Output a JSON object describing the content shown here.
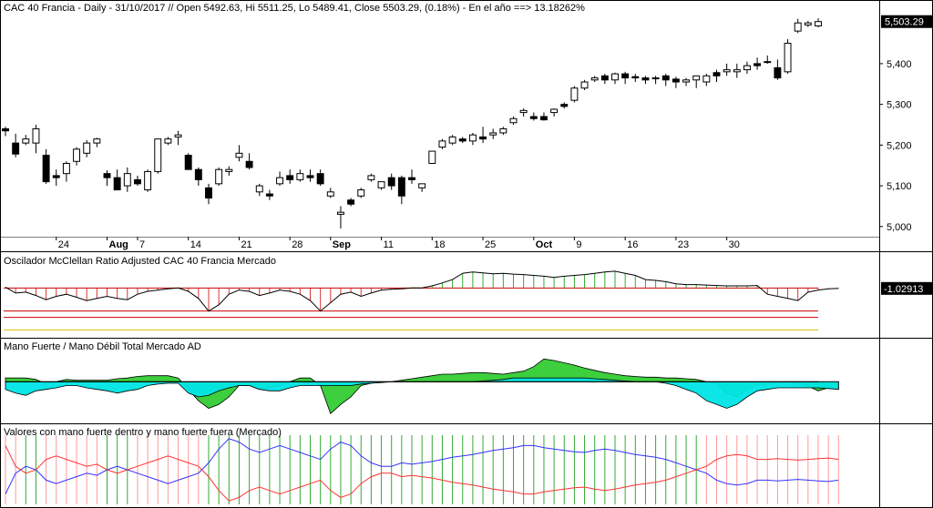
{
  "chart_data": [
    {
      "type": "candlestick",
      "title": "CAC 40 Francia - Daily - 31/10/2017 // Open 5492.63, Hi 5511.25, Lo 5489.41, Close 5503.29, (0.18%) - En el año ==> 13.18262%",
      "ylim": [
        4975,
        5525
      ],
      "yticks": [
        5000,
        5100,
        5200,
        5300,
        5400
      ],
      "ytick_labels": [
        "5,000",
        "5,100",
        "5,200",
        "5,300",
        "5,400"
      ],
      "last_value_label": "5,503.29",
      "last_value": 5503.29,
      "x_ticks": [
        {
          "i": 5,
          "label": "24",
          "bold": false
        },
        {
          "i": 10,
          "label": "Aug",
          "bold": true
        },
        {
          "i": 13,
          "label": "7",
          "bold": false
        },
        {
          "i": 18,
          "label": "14",
          "bold": false
        },
        {
          "i": 23,
          "label": "21",
          "bold": false
        },
        {
          "i": 28,
          "label": "28",
          "bold": false
        },
        {
          "i": 32,
          "label": "Sep",
          "bold": true
        },
        {
          "i": 37,
          "label": "11",
          "bold": false
        },
        {
          "i": 42,
          "label": "18",
          "bold": false
        },
        {
          "i": 47,
          "label": "25",
          "bold": false
        },
        {
          "i": 52,
          "label": "Oct",
          "bold": true
        },
        {
          "i": 56,
          "label": "9",
          "bold": false
        },
        {
          "i": 61,
          "label": "16",
          "bold": false
        },
        {
          "i": 66,
          "label": "23",
          "bold": false
        },
        {
          "i": 71,
          "label": "30",
          "bold": false
        }
      ],
      "ohlc": [
        [
          5240,
          5245,
          5222,
          5235
        ],
        [
          5205,
          5228,
          5170,
          5178
        ],
        [
          5205,
          5225,
          5200,
          5215
        ],
        [
          5205,
          5250,
          5180,
          5240
        ],
        [
          5175,
          5190,
          5105,
          5110
        ],
        [
          5125,
          5140,
          5100,
          5120
        ],
        [
          5130,
          5160,
          5110,
          5155
        ],
        [
          5160,
          5195,
          5150,
          5190
        ],
        [
          5180,
          5212,
          5170,
          5205
        ],
        [
          5205,
          5218,
          5195,
          5215
        ],
        [
          5130,
          5138,
          5100,
          5120
        ],
        [
          5120,
          5140,
          5090,
          5090
        ],
        [
          5100,
          5145,
          5085,
          5130
        ],
        [
          5115,
          5125,
          5100,
          5105
        ],
        [
          5090,
          5140,
          5085,
          5135
        ],
        [
          5135,
          5215,
          5130,
          5215
        ],
        [
          5205,
          5220,
          5200,
          5215
        ],
        [
          5220,
          5235,
          5200,
          5225
        ],
        [
          5175,
          5180,
          5140,
          5140
        ],
        [
          5140,
          5145,
          5100,
          5115
        ],
        [
          5095,
          5105,
          5055,
          5070
        ],
        [
          5105,
          5145,
          5100,
          5140
        ],
        [
          5135,
          5148,
          5125,
          5140
        ],
        [
          5170,
          5200,
          5160,
          5180
        ],
        [
          5160,
          5180,
          5140,
          5145
        ],
        [
          5085,
          5105,
          5075,
          5100
        ],
        [
          5080,
          5090,
          5065,
          5075
        ],
        [
          5105,
          5135,
          5100,
          5120
        ],
        [
          5125,
          5140,
          5105,
          5115
        ],
        [
          5115,
          5140,
          5110,
          5130
        ],
        [
          5125,
          5140,
          5110,
          5120
        ],
        [
          5130,
          5140,
          5100,
          5105
        ],
        [
          5075,
          5095,
          5070,
          5085
        ],
        [
          5030,
          5050,
          4995,
          5035
        ],
        [
          5065,
          5070,
          5050,
          5055
        ],
        [
          5075,
          5095,
          5070,
          5090
        ],
        [
          5115,
          5130,
          5110,
          5125
        ],
        [
          5095,
          5105,
          5090,
          5110
        ],
        [
          5120,
          5130,
          5090,
          5100
        ],
        [
          5120,
          5125,
          5055,
          5075
        ],
        [
          5120,
          5140,
          5105,
          5115
        ],
        [
          5095,
          5105,
          5085,
          5105
        ],
        [
          5155,
          5185,
          5155,
          5185
        ],
        [
          5195,
          5215,
          5190,
          5210
        ],
        [
          5205,
          5225,
          5200,
          5220
        ],
        [
          5215,
          5220,
          5205,
          5210
        ],
        [
          5210,
          5230,
          5200,
          5225
        ],
        [
          5220,
          5245,
          5205,
          5215
        ],
        [
          5225,
          5240,
          5215,
          5230
        ],
        [
          5230,
          5245,
          5225,
          5240
        ],
        [
          5255,
          5270,
          5250,
          5265
        ],
        [
          5280,
          5290,
          5270,
          5285
        ],
        [
          5270,
          5280,
          5260,
          5265
        ],
        [
          5270,
          5280,
          5260,
          5262
        ],
        [
          5280,
          5290,
          5270,
          5288
        ],
        [
          5300,
          5305,
          5290,
          5295
        ],
        [
          5310,
          5345,
          5305,
          5340
        ],
        [
          5340,
          5360,
          5335,
          5355
        ],
        [
          5360,
          5370,
          5355,
          5365
        ],
        [
          5370,
          5375,
          5350,
          5360
        ],
        [
          5360,
          5378,
          5350,
          5375
        ],
        [
          5375,
          5380,
          5350,
          5365
        ],
        [
          5368,
          5375,
          5355,
          5365
        ],
        [
          5365,
          5370,
          5350,
          5360
        ],
        [
          5365,
          5370,
          5350,
          5365
        ],
        [
          5370,
          5375,
          5345,
          5360
        ],
        [
          5362,
          5368,
          5340,
          5355
        ],
        [
          5355,
          5365,
          5345,
          5360
        ],
        [
          5360,
          5370,
          5340,
          5370
        ],
        [
          5355,
          5375,
          5345,
          5370
        ],
        [
          5378,
          5385,
          5355,
          5370
        ],
        [
          5380,
          5400,
          5370,
          5385
        ],
        [
          5380,
          5400,
          5365,
          5385
        ],
        [
          5385,
          5405,
          5375,
          5395
        ],
        [
          5400,
          5415,
          5385,
          5395
        ],
        [
          5405,
          5420,
          5400,
          5405
        ],
        [
          5390,
          5410,
          5360,
          5365
        ],
        [
          5380,
          5460,
          5375,
          5450
        ],
        [
          5480,
          5510,
          5475,
          5500
        ],
        [
          5495,
          5505,
          5490,
          5500
        ],
        [
          5492.63,
          5511.25,
          5489.41,
          5503.29
        ]
      ]
    },
    {
      "type": "histogram-line",
      "title": "Oscilador McClellan Ratio Adjusted CAC 40 Francia Mercado",
      "ylim": [
        -110,
        55
      ],
      "last_value_label": "-1.02913",
      "reference_lines": [
        {
          "value": -55,
          "color": "#cc0000"
        },
        {
          "value": -70,
          "color": "#cc0000"
        },
        {
          "value": -100,
          "color": "#e0c000"
        }
      ],
      "values": [
        2,
        -12,
        -10,
        -18,
        -28,
        -20,
        -15,
        -22,
        -30,
        -25,
        -20,
        -25,
        -28,
        -15,
        -8,
        -5,
        -2,
        0,
        -8,
        -25,
        -55,
        -40,
        -15,
        -5,
        -8,
        -18,
        -12,
        -5,
        -8,
        -15,
        -30,
        -55,
        -35,
        -15,
        -10,
        -20,
        -12,
        -5,
        -3,
        -2,
        0,
        0,
        5,
        12,
        20,
        35,
        38,
        36,
        34,
        35,
        33,
        32,
        30,
        28,
        25,
        28,
        30,
        32,
        35,
        38,
        40,
        35,
        30,
        20,
        18,
        15,
        10,
        8,
        8,
        7,
        6,
        5,
        5,
        5,
        6,
        -15,
        -20,
        -25,
        -30,
        -10,
        -5,
        -2,
        -1.02913
      ]
    },
    {
      "type": "area-dual",
      "title": "Mano Fuerte / Mano Débil Total Mercado AD",
      "ylim": [
        -50,
        40
      ],
      "series": [
        {
          "name": "",
          "color": "#33cc33",
          "values": [
            5,
            5,
            5,
            3,
            -3,
            0,
            3,
            2,
            2,
            2,
            2,
            4,
            5,
            7,
            8,
            8,
            8,
            5,
            -10,
            -25,
            -35,
            -30,
            -20,
            -5,
            -5,
            -10,
            -8,
            -5,
            0,
            5,
            5,
            -5,
            -42,
            -30,
            -20,
            -5,
            -2,
            0,
            0,
            2,
            4,
            6,
            8,
            10,
            10,
            11,
            12,
            12,
            11,
            10,
            12,
            14,
            20,
            30,
            28,
            25,
            22,
            18,
            15,
            12,
            10,
            8,
            7,
            6,
            6,
            5,
            5,
            4,
            3,
            0,
            -2,
            -15,
            -20,
            -10,
            -5,
            -3,
            -1,
            0,
            -2,
            -6,
            -12,
            -8,
            -10
          ]
        },
        {
          "name": "",
          "color": "#00e5e5",
          "values": [
            -10,
            -15,
            -18,
            -12,
            -10,
            -8,
            -5,
            -5,
            -8,
            -10,
            -12,
            -15,
            -12,
            -10,
            -5,
            -3,
            -2,
            -2,
            -15,
            -20,
            -18,
            -12,
            -8,
            -5,
            -5,
            -10,
            -12,
            -12,
            -8,
            -5,
            -5,
            -5,
            -5,
            -5,
            -5,
            -3,
            -2,
            -1,
            0,
            0,
            0,
            0,
            0,
            0,
            0,
            0,
            0,
            1,
            2,
            3,
            5,
            5,
            5,
            5,
            5,
            5,
            5,
            5,
            4,
            3,
            2,
            1,
            0,
            0,
            0,
            -2,
            -5,
            -10,
            -15,
            -25,
            -30,
            -35,
            -30,
            -20,
            -12,
            -10,
            -8,
            -8,
            -8,
            -8,
            -8,
            -9,
            -10
          ]
        }
      ]
    },
    {
      "type": "dual-line-bars",
      "title": "Valores con mano fuerte dentro y mano fuerte fuera (Mercado)",
      "ylim": [
        0,
        100
      ],
      "series": [
        {
          "name": "",
          "color": "#3333ff",
          "values": [
            15,
            45,
            55,
            50,
            35,
            30,
            35,
            40,
            45,
            42,
            50,
            55,
            50,
            45,
            40,
            35,
            30,
            35,
            40,
            45,
            60,
            80,
            95,
            90,
            80,
            75,
            80,
            85,
            80,
            75,
            70,
            65,
            80,
            90,
            85,
            70,
            60,
            55,
            55,
            60,
            58,
            60,
            62,
            65,
            68,
            70,
            72,
            75,
            78,
            80,
            82,
            85,
            85,
            82,
            80,
            78,
            76,
            75,
            78,
            80,
            78,
            75,
            72,
            70,
            68,
            65,
            60,
            55,
            50,
            45,
            35,
            30,
            28,
            30,
            35,
            35,
            34,
            35,
            36,
            35,
            34,
            33,
            35
          ]
        },
        {
          "name": "",
          "color": "#ff3333",
          "values": [
            85,
            55,
            45,
            50,
            65,
            70,
            65,
            60,
            55,
            58,
            50,
            45,
            50,
            55,
            60,
            65,
            70,
            65,
            60,
            55,
            40,
            20,
            5,
            10,
            20,
            25,
            20,
            15,
            20,
            25,
            30,
            35,
            20,
            10,
            15,
            30,
            40,
            45,
            45,
            40,
            42,
            40,
            38,
            35,
            32,
            30,
            28,
            25,
            22,
            20,
            18,
            15,
            15,
            18,
            20,
            22,
            24,
            25,
            22,
            20,
            22,
            25,
            28,
            30,
            32,
            35,
            40,
            45,
            50,
            55,
            65,
            70,
            72,
            70,
            65,
            65,
            66,
            65,
            64,
            65,
            66,
            67,
            65
          ]
        }
      ],
      "bar_colors": [
        "#33aa33",
        "#ff9999"
      ]
    }
  ]
}
